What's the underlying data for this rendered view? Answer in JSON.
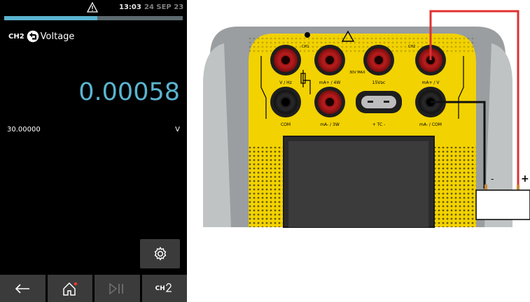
{
  "status": {
    "time": "13:03",
    "date": "24 SEP 23",
    "progress_fraction": 0.52
  },
  "channel": {
    "name": "CH2",
    "function_label": "Voltage",
    "function_icon": "return-arrow-icon"
  },
  "measurement": {
    "reading": "0.00058",
    "range_value": "30.00000",
    "unit": "V"
  },
  "navbar": {
    "buttons": [
      {
        "icon": "back-arrow-icon"
      },
      {
        "icon": "home-icon"
      },
      {
        "icon": "play-pause-icon"
      },
      {
        "icon": "channel-select-icon",
        "label": "CH"
      }
    ]
  },
  "settings": {
    "icon": "gear-icon"
  },
  "instrument": {
    "terminals_top": [
      "V / Hz",
      "mA+ / 4W",
      "15Vᴅᴄ",
      "mA+ / V"
    ],
    "terminals_bottom": [
      "COM",
      "mA- / 3W",
      "+ TC -",
      "mA- / COM"
    ],
    "marks": [
      "CH1",
      "CH2",
      "30V MAX"
    ],
    "source_polarity": {
      "minus": "-",
      "plus": "+"
    }
  },
  "colors": {
    "accent": "#5ab4cf",
    "background": "#000000",
    "button": "#3b3b3b",
    "panel_yellow": "#f2d200",
    "wire_red": "#e03030"
  }
}
